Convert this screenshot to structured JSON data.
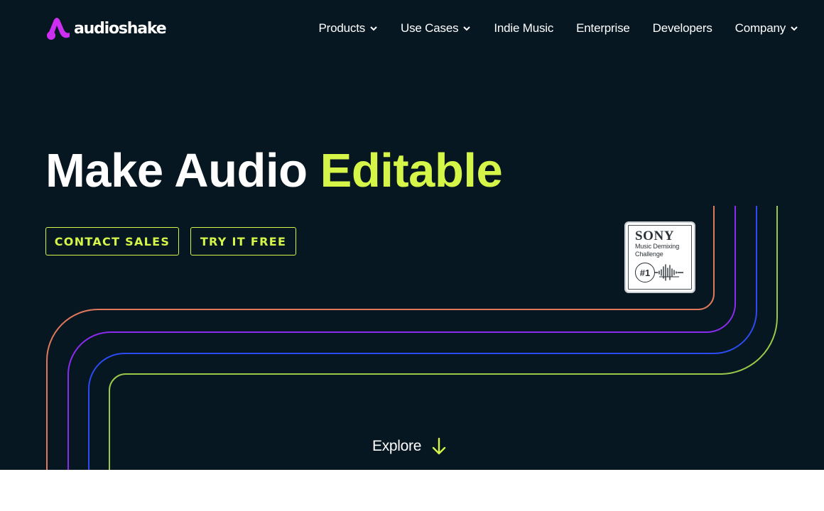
{
  "brand": {
    "name": "audioshake",
    "accent_color": "#d6f549",
    "logo_color": "#cc2ff2",
    "background_color": "#061722"
  },
  "nav": {
    "items": [
      {
        "label": "Products",
        "has_dropdown": true,
        "icon": "chevron-down-icon"
      },
      {
        "label": "Use Cases",
        "has_dropdown": true,
        "icon": "chevron-down-icon"
      },
      {
        "label": "Indie Music",
        "has_dropdown": false
      },
      {
        "label": "Enterprise",
        "has_dropdown": false
      },
      {
        "label": "Developers",
        "has_dropdown": false
      },
      {
        "label": "Company",
        "has_dropdown": true,
        "icon": "chevron-down-icon"
      }
    ]
  },
  "hero": {
    "headline_prefix": "Make Audio",
    "headline_accent": "Editable",
    "buttons": {
      "contact_sales": "CONTACT SALES",
      "try_free": "TRY IT FREE"
    },
    "line_colors": [
      "#e0785c",
      "#8a2cf0",
      "#2c4bf0",
      "#9ac94a"
    ]
  },
  "badge": {
    "title": "SONY",
    "line1": "Music Demixing",
    "line2": "Challenge",
    "rank": "#1",
    "icon": "waveform-icon"
  },
  "explore": {
    "label": "Explore",
    "icon": "arrow-down-icon"
  }
}
